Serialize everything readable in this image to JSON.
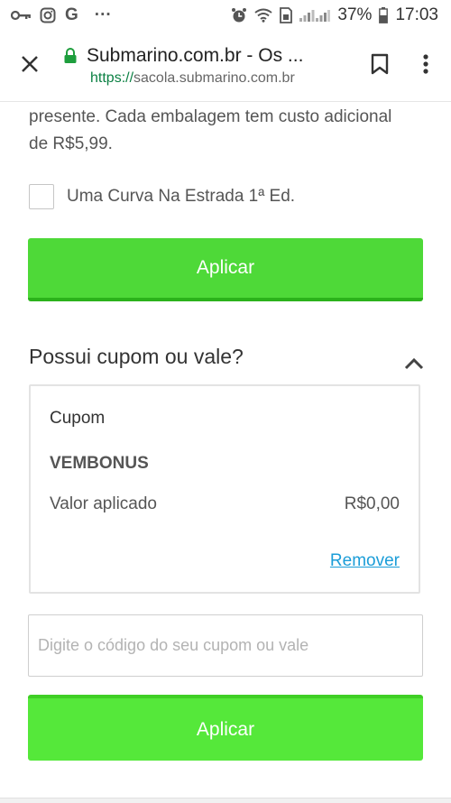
{
  "status_bar": {
    "battery": "37%",
    "time": "17:03",
    "more": "···",
    "g_letter": "G"
  },
  "browser": {
    "page_title": "Submarino.com.br - Os ...",
    "url_scheme": "https://",
    "url_host": "sacola.submarino.com.br",
    "secure_color": "#1e9e3d"
  },
  "gift_wrap": {
    "description": "presente. Cada embalagem tem custo adicional de R$5,99.",
    "item_label": "Uma Curva Na Estrada 1ª Ed.",
    "item_checked": false,
    "apply_label": "Aplicar"
  },
  "coupon": {
    "heading": "Possui cupom ou vale?",
    "card_label": "Cupom",
    "code": "VEMBONUS",
    "applied_label": "Valor aplicado",
    "applied_value": "R$0,00",
    "remove_label": "Remover",
    "input_placeholder": "Digite o código do seu cupom ou vale",
    "input_value": "",
    "apply_label": "Aplicar"
  },
  "colors": {
    "apply_green": "#4ed938",
    "link_blue": "#1b9dd8"
  },
  "icons": [
    "key-icon",
    "instagram-icon",
    "google-icon",
    "alarm-icon",
    "wifi-icon",
    "sim-icon",
    "signal-icon",
    "battery-icon",
    "close-icon",
    "lock-icon",
    "bookmark-icon",
    "more-vert-icon",
    "chevron-up-icon"
  ]
}
